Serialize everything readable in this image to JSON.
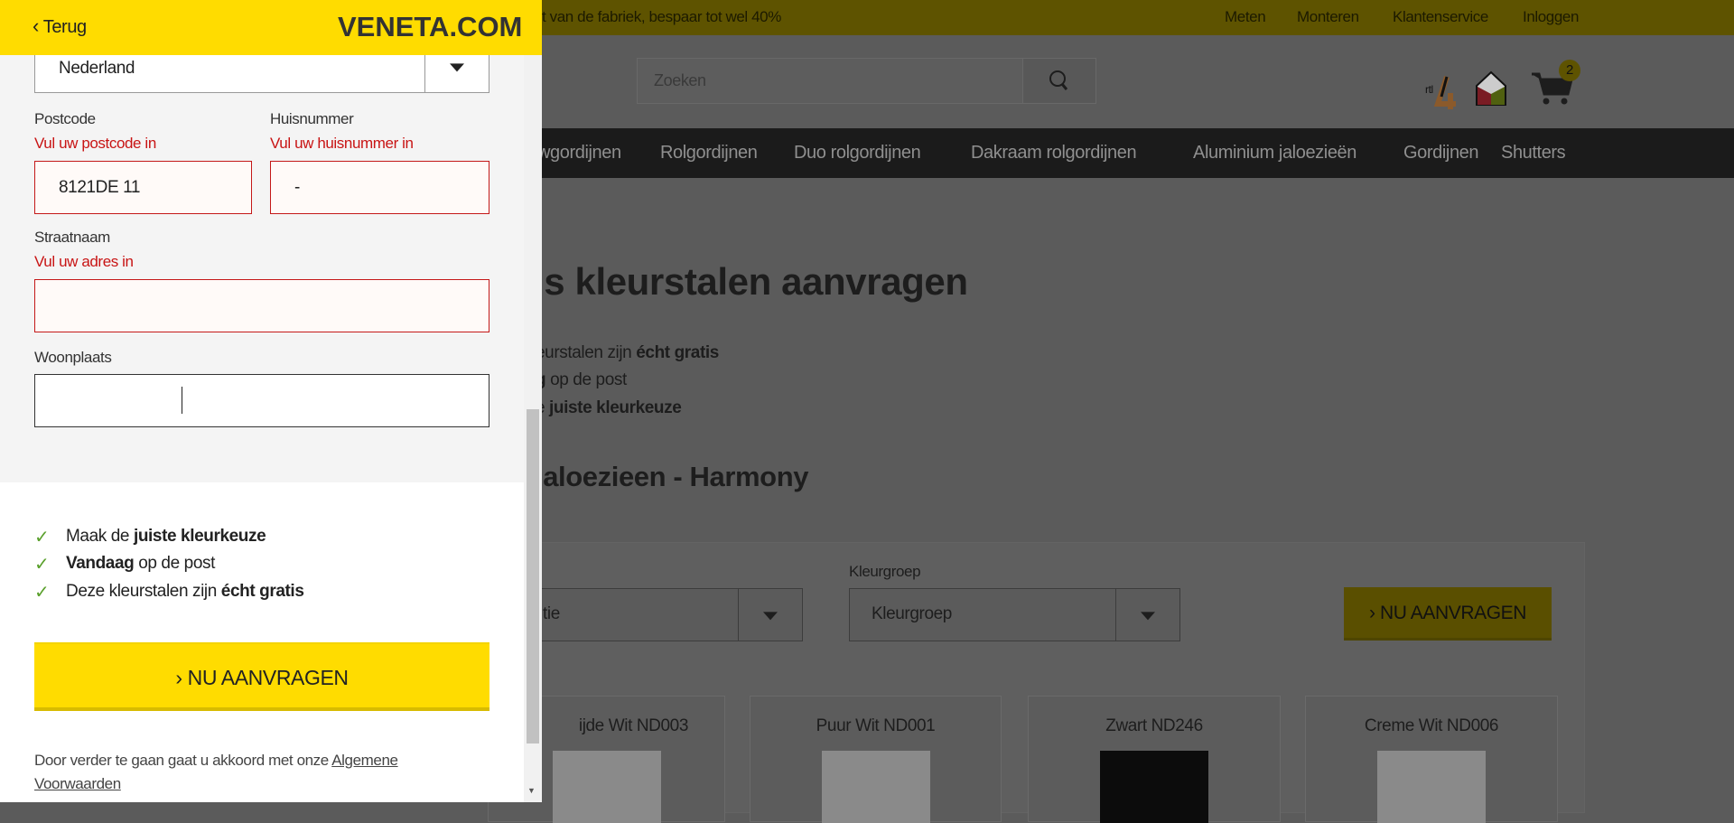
{
  "topbar": {
    "promo": "t van de fabriek, bespaar tot wel 40%",
    "links": [
      "Meten",
      "Monteren",
      "Klantenservice",
      "Inloggen"
    ]
  },
  "search": {
    "placeholder": "Zoeken"
  },
  "cart": {
    "count": "2"
  },
  "badges": {
    "rtl": "rtl"
  },
  "nav": [
    "wgordijnen",
    "Rolgordijnen",
    "Duo rolgordijnen",
    "Dakraam rolgordijnen",
    "Aluminium jaloezieën",
    "Gordijnen",
    "Shutters"
  ],
  "page": {
    "title": "is kleurstalen aanvragen",
    "bullets": [
      {
        "pre": "eurstalen zijn ",
        "bold": "écht gratis"
      },
      {
        "bold": "g",
        "post": " op de post"
      },
      {
        "pre": "e ",
        "bold": "juiste kleurkeuze"
      }
    ],
    "subtitle": "jaloezieen - Harmony",
    "filter": {
      "left_value": "tie",
      "group_label": "Kleurgroep",
      "group_value": "Kleurgroep",
      "button": "NU AANVRAGEN"
    },
    "cards": [
      "ijde Wit ND003",
      "Puur Wit ND001",
      "Zwart ND246",
      "Creme Wit ND006"
    ]
  },
  "panel": {
    "back": "Terug",
    "logo": "VENETA.COM",
    "country": "Nederland",
    "postcode": {
      "label": "Postcode",
      "error": "Vul uw postcode in",
      "value": "8121DE 11"
    },
    "huisnummer": {
      "label": "Huisnummer",
      "error": "Vul uw huisnummer in",
      "value": "-"
    },
    "straat": {
      "label": "Straatnaam",
      "error": "Vul uw adres in",
      "value": ""
    },
    "woonplaats": {
      "label": "Woonplaats",
      "value": ""
    },
    "checks": [
      {
        "pre": "Maak de ",
        "bold": "juiste kleurkeuze",
        "post": ""
      },
      {
        "pre": "",
        "bold": "Vandaag",
        "post": " op de post"
      },
      {
        "pre": "Deze kleurstalen zijn ",
        "bold": "écht gratis",
        "post": ""
      }
    ],
    "cta": "NU AANVRAGEN",
    "footer": "Door verder te gaan gaat u akkoord met onze ",
    "footer_link": "Algemene Voorwaarden"
  },
  "colors": {
    "accent": "#ffdc00",
    "error": "#c81414",
    "check": "#5aa02c"
  }
}
